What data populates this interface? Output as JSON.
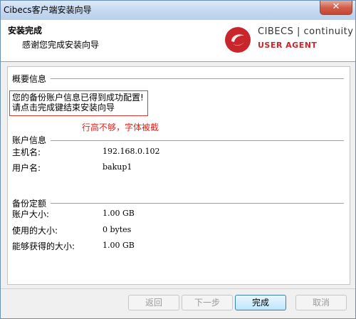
{
  "window": {
    "title": "Cibecs客户端安装向导",
    "close_symbol": "✕"
  },
  "header": {
    "title": "安装完成",
    "subtitle": "感谢您完成安装向导",
    "logo": {
      "brand": "CIBECS | continuity",
      "agent": "USER AGENT",
      "accent_color": "#c8262b"
    }
  },
  "summary": {
    "heading": "概要信息",
    "message_line1": "您的备份账户信息已得到成功配置!",
    "message_line2": "请点击完成键结束安装向导",
    "annotation": "行高不够，字体被截"
  },
  "account": {
    "heading": "账户信息",
    "host_label": "主机名:",
    "host_value": "192.168.0.102",
    "user_label": "用户名:",
    "user_value": "bakup1"
  },
  "quota": {
    "heading": "备份定额",
    "account_size_label": "账户大小:",
    "account_size_value": "1.00 GB",
    "used_size_label": "使用的大小:",
    "used_size_value": "0 bytes",
    "available_size_label": "能够获得的大小:",
    "available_size_value": "1.00 GB"
  },
  "buttons": {
    "back": "返回",
    "next": "下一步",
    "finish": "完成",
    "cancel": "取消"
  }
}
